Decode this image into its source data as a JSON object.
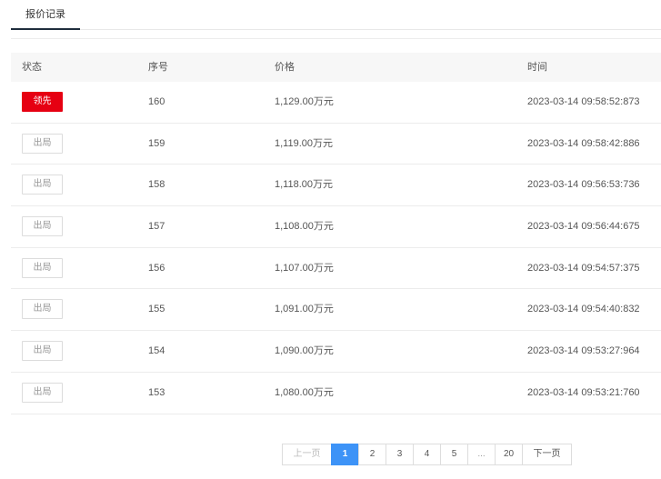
{
  "tabs": [
    {
      "label": "报价记录"
    }
  ],
  "table": {
    "headers": {
      "status": "状态",
      "seq": "序号",
      "price": "价格",
      "time": "时间"
    },
    "rows": [
      {
        "status": "领先",
        "status_type": "lead",
        "seq": "160",
        "price": "1,129.00万元",
        "time": "2023-03-14 09:58:52:873"
      },
      {
        "status": "出局",
        "status_type": "out",
        "seq": "159",
        "price": "1,119.00万元",
        "time": "2023-03-14 09:58:42:886"
      },
      {
        "status": "出局",
        "status_type": "out",
        "seq": "158",
        "price": "1,118.00万元",
        "time": "2023-03-14 09:56:53:736"
      },
      {
        "status": "出局",
        "status_type": "out",
        "seq": "157",
        "price": "1,108.00万元",
        "time": "2023-03-14 09:56:44:675"
      },
      {
        "status": "出局",
        "status_type": "out",
        "seq": "156",
        "price": "1,107.00万元",
        "time": "2023-03-14 09:54:57:375"
      },
      {
        "status": "出局",
        "status_type": "out",
        "seq": "155",
        "price": "1,091.00万元",
        "time": "2023-03-14 09:54:40:832"
      },
      {
        "status": "出局",
        "status_type": "out",
        "seq": "154",
        "price": "1,090.00万元",
        "time": "2023-03-14 09:53:27:964"
      },
      {
        "status": "出局",
        "status_type": "out",
        "seq": "153",
        "price": "1,080.00万元",
        "time": "2023-03-14 09:53:21:760"
      }
    ]
  },
  "pagination": {
    "prev": "上一页",
    "pages": [
      "1",
      "2",
      "3",
      "4",
      "5",
      "...",
      "20"
    ],
    "current": "1",
    "next": "下一页"
  },
  "colors": {
    "lead": "#e60012",
    "active_page": "#3d93f7"
  }
}
